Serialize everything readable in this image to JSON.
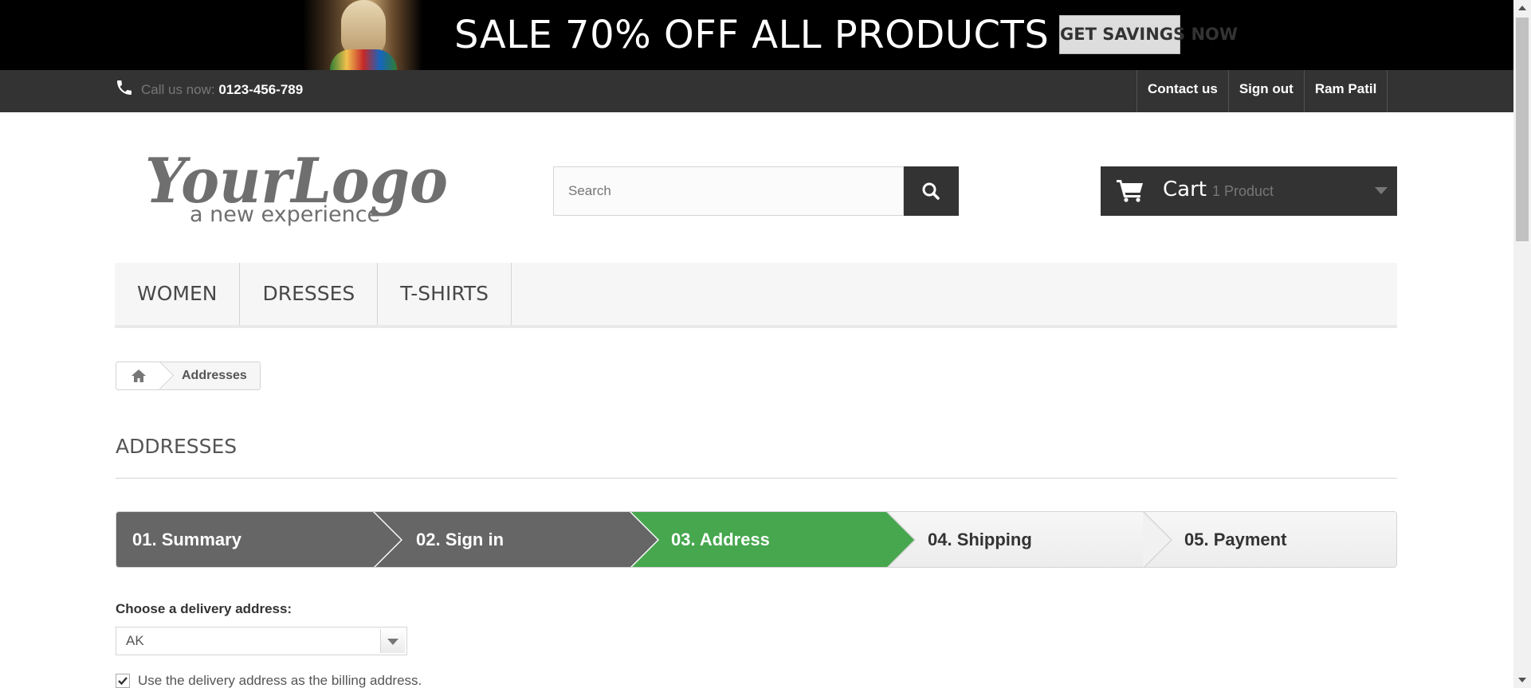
{
  "banner": {
    "text": "SALE 70% OFF ALL PRODUCTS",
    "button_label": "GET SAVINGS NOW"
  },
  "topbar": {
    "call_label": "Call us now:",
    "phone_number": "0123-456-789",
    "links": [
      "Contact us",
      "Sign out",
      "Ram Patil"
    ]
  },
  "header": {
    "logo_text": "YourLogo",
    "logo_tagline": "a new experience",
    "search_placeholder": "Search",
    "cart_label": "Cart",
    "cart_quantity": "1 Product"
  },
  "menu": {
    "items": [
      "WOMEN",
      "DRESSES",
      "T-SHIRTS"
    ]
  },
  "breadcrumb": {
    "current": "Addresses"
  },
  "page": {
    "heading": "Addresses"
  },
  "steps": [
    {
      "label": "01. Summary",
      "state": "done"
    },
    {
      "label": "02. Sign in",
      "state": "done"
    },
    {
      "label": "03. Address",
      "state": "current"
    },
    {
      "label": "04. Shipping",
      "state": "todo"
    },
    {
      "label": "05. Payment",
      "state": "todo"
    }
  ],
  "address_form": {
    "delivery_label": "Choose a delivery address:",
    "delivery_value": "AK",
    "billing_same_checked": true,
    "billing_same_label": "Use the delivery address as the billing address."
  },
  "colors": {
    "step_done": "#666666",
    "step_current": "#46a74e",
    "dark_bar": "#333333"
  }
}
